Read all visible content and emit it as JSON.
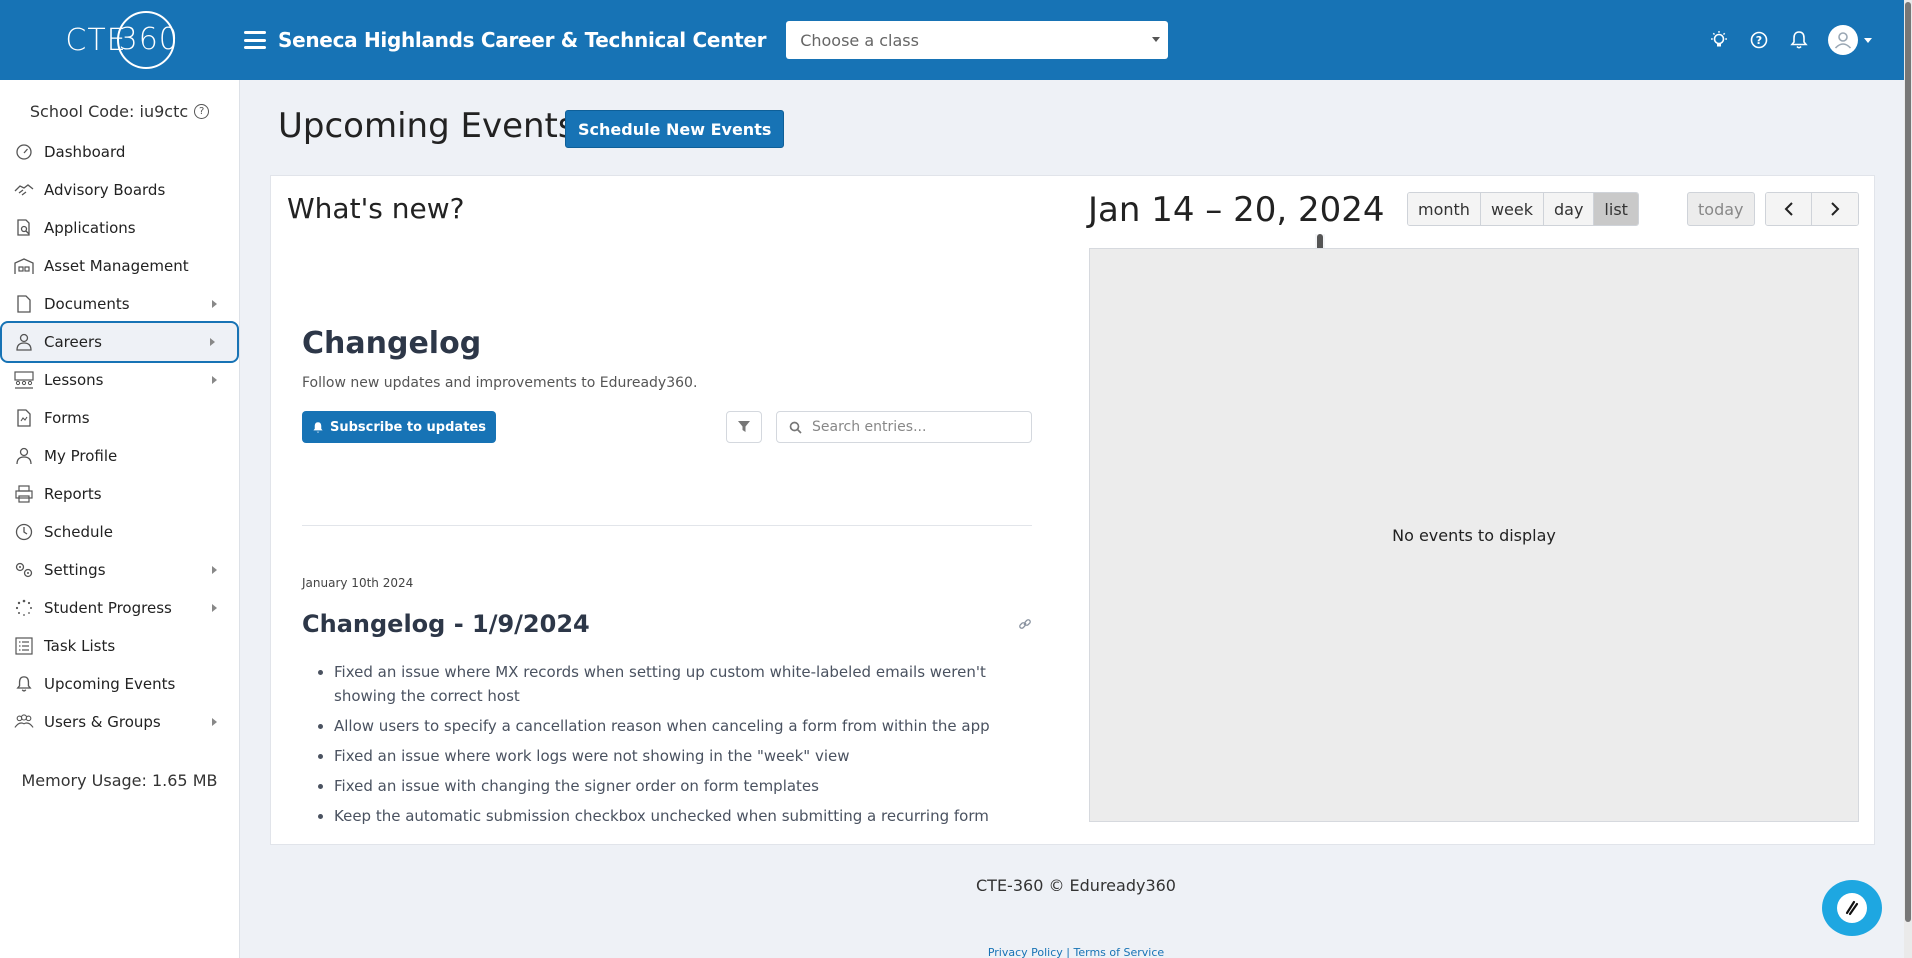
{
  "header": {
    "logo_text": "CTE",
    "logo_number": "360",
    "school_name": "Seneca Highlands Career & Technical Center",
    "class_select_placeholder": "Choose a class"
  },
  "sidebar": {
    "school_code_label": "School Code: iu9ctc",
    "items": [
      {
        "label": "Dashboard",
        "icon": "gauge-icon",
        "has_children": false
      },
      {
        "label": "Advisory Boards",
        "icon": "handshake-icon",
        "has_children": false
      },
      {
        "label": "Applications",
        "icon": "document-search-icon",
        "has_children": false
      },
      {
        "label": "Asset Management",
        "icon": "warehouse-icon",
        "has_children": false
      },
      {
        "label": "Documents",
        "icon": "file-icon",
        "has_children": true
      },
      {
        "label": "Careers",
        "icon": "user-tie-icon",
        "has_children": true,
        "active": true
      },
      {
        "label": "Lessons",
        "icon": "classroom-icon",
        "has_children": true
      },
      {
        "label": "Forms",
        "icon": "form-icon",
        "has_children": false
      },
      {
        "label": "My Profile",
        "icon": "user-icon",
        "has_children": false
      },
      {
        "label": "Reports",
        "icon": "printer-icon",
        "has_children": false
      },
      {
        "label": "Schedule",
        "icon": "clock-icon",
        "has_children": false
      },
      {
        "label": "Settings",
        "icon": "gears-icon",
        "has_children": true
      },
      {
        "label": "Student Progress",
        "icon": "spinner-icon",
        "has_children": true
      },
      {
        "label": "Task Lists",
        "icon": "list-icon",
        "has_children": false
      },
      {
        "label": "Upcoming Events",
        "icon": "bell-icon",
        "has_children": false
      },
      {
        "label": "Users & Groups",
        "icon": "users-icon",
        "has_children": true
      }
    ],
    "memory_usage": "Memory Usage: 1.65 MB"
  },
  "main": {
    "title": "Upcoming Events",
    "schedule_button": "Schedule New Events",
    "whats_new": "What's new?",
    "changelog": {
      "title": "Changelog",
      "subtitle": "Follow new updates and improvements to Eduready360.",
      "subscribe_button": "Subscribe to updates",
      "search_placeholder": "Search entries...",
      "entry": {
        "date": "January 10th 2024",
        "title": "Changelog - 1/9/2024",
        "items": [
          "Fixed an issue where MX records when setting up custom white-labeled emails weren't showing the correct host",
          "Allow users to specify a cancellation reason when canceling a form from within the app",
          "Fixed an issue where work logs were not showing in the \"week\" view",
          "Fixed an issue with changing the signer order on form templates",
          "Keep the automatic submission checkbox unchecked when submitting a recurring form"
        ]
      }
    },
    "calendar": {
      "range": "Jan 14 – 20, 2024",
      "views": [
        "month",
        "week",
        "day",
        "list"
      ],
      "active_view": "list",
      "today_button": "today",
      "empty_message": "No events to display"
    }
  },
  "footer": {
    "copyright": "CTE-360 © Eduready360",
    "privacy": "Privacy Policy",
    "separator": " | ",
    "terms": "Terms of Service"
  },
  "colors": {
    "brand": "#1773b5",
    "background": "#eef1f6"
  }
}
